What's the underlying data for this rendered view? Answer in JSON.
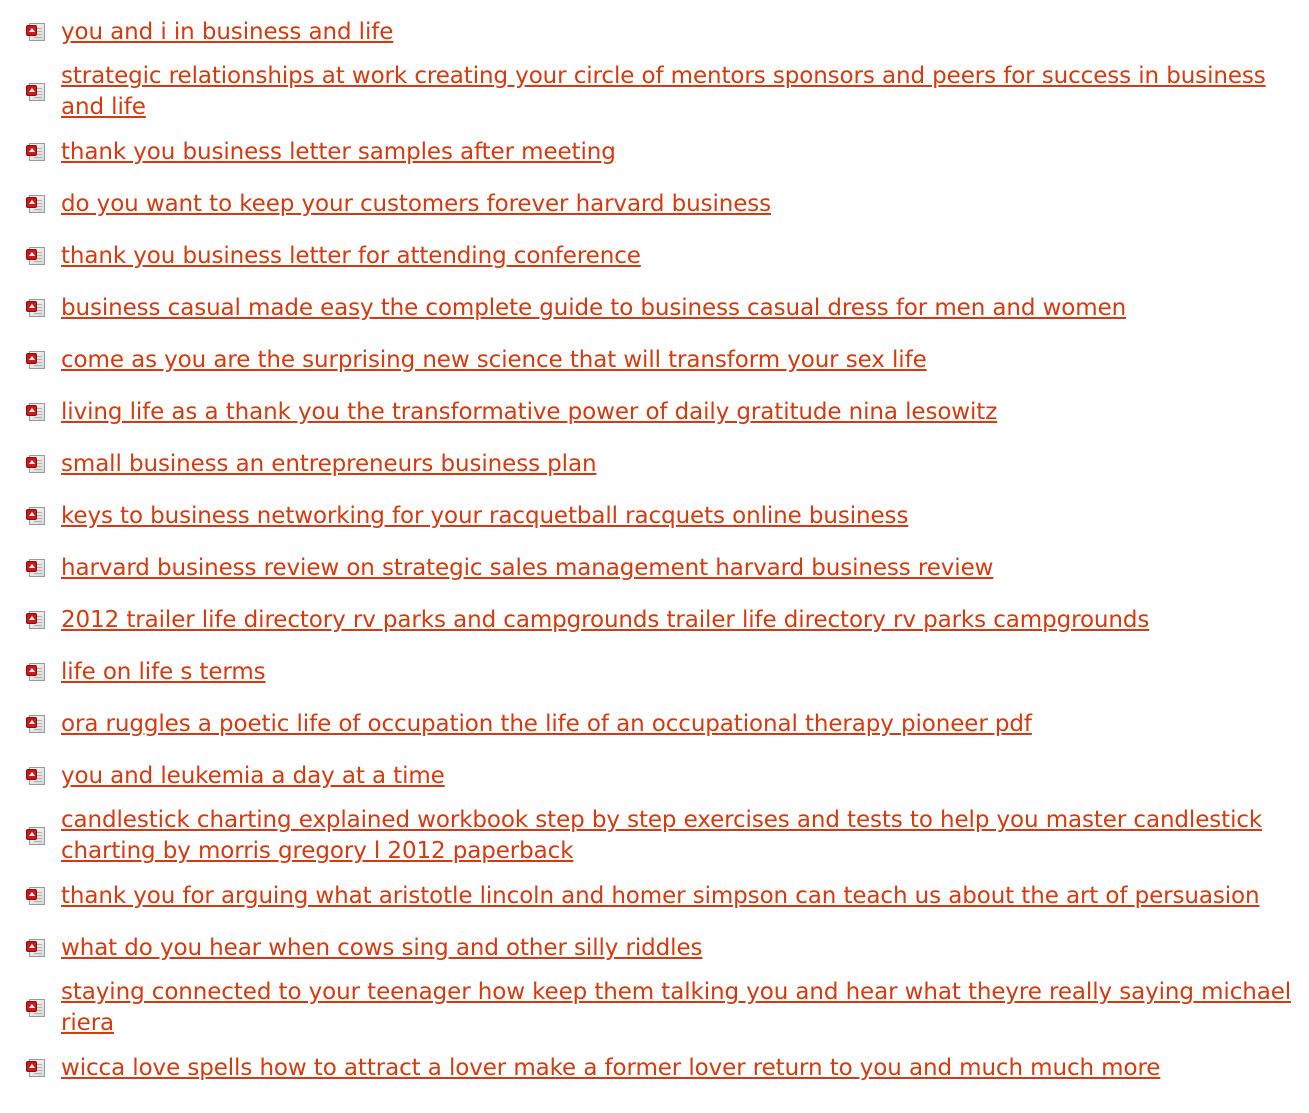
{
  "links": [
    {
      "label": "you and i in business and life",
      "icon": "pdf-icon"
    },
    {
      "label": "strategic relationships at work creating your circle of mentors sponsors and peers for success in business and life",
      "icon": "pdf-icon"
    },
    {
      "label": "thank you business letter samples after meeting",
      "icon": "pdf-icon"
    },
    {
      "label": "do you want to keep your customers forever harvard business",
      "icon": "pdf-icon"
    },
    {
      "label": "thank you business letter for attending conference",
      "icon": "pdf-icon"
    },
    {
      "label": "business casual made easy the complete guide to business casual dress for men and women",
      "icon": "pdf-icon"
    },
    {
      "label": "come as you are the surprising new science that will transform your sex life",
      "icon": "pdf-icon"
    },
    {
      "label": "living life as a thank you the transformative power of daily gratitude nina lesowitz",
      "icon": "pdf-icon"
    },
    {
      "label": "small business an entrepreneurs business plan",
      "icon": "pdf-icon"
    },
    {
      "label": "keys to business networking for your racquetball racquets online business",
      "icon": "pdf-icon"
    },
    {
      "label": "harvard business review on strategic sales management harvard business review",
      "icon": "pdf-icon"
    },
    {
      "label": "2012 trailer life directory rv parks and campgrounds trailer life directory rv parks campgrounds",
      "icon": "pdf-icon"
    },
    {
      "label": "life on life s terms",
      "icon": "pdf-icon"
    },
    {
      "label": "ora ruggles a poetic life of occupation the life of an occupational therapy pioneer pdf",
      "icon": "pdf-icon"
    },
    {
      "label": "you and leukemia a day at a time",
      "icon": "pdf-icon"
    },
    {
      "label": "candlestick charting explained workbook step by step exercises and tests to help you master candlestick charting by morris gregory l 2012 paperback",
      "icon": "pdf-icon"
    },
    {
      "label": "thank you for arguing what aristotle lincoln and homer simpson can teach us about the art of persuasion",
      "icon": "pdf-icon"
    },
    {
      "label": "what do you hear when cows sing and other silly riddles",
      "icon": "pdf-icon"
    },
    {
      "label": "staying connected to your teenager how keep them talking you and hear what theyre really saying michael riera",
      "icon": "pdf-icon"
    },
    {
      "label": "wicca love spells how to attract a lover make a former lover return to you and much much more",
      "icon": "pdf-icon"
    }
  ],
  "colors": {
    "link": "#d83a0e",
    "background": "#ffffff",
    "icon_badge": "#d01818"
  }
}
